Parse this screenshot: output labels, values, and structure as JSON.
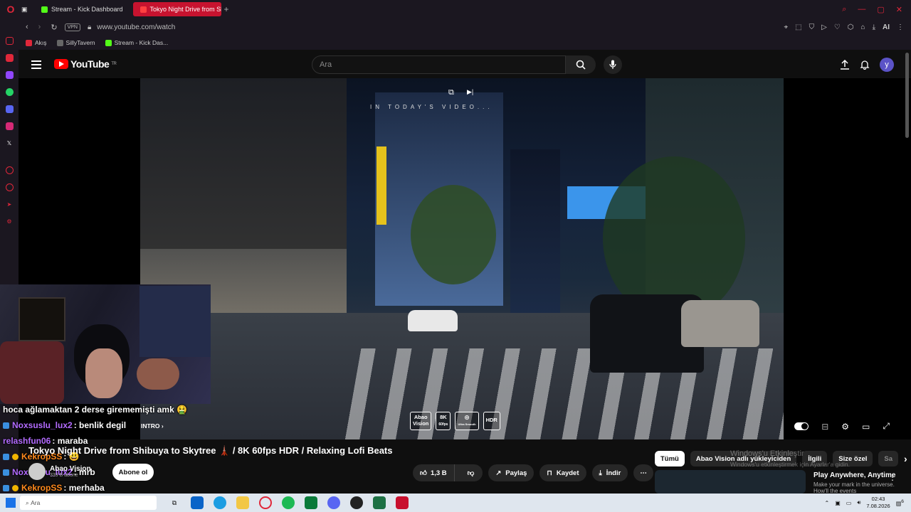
{
  "browser": {
    "tabs": [
      {
        "label": "Stream - Kick Dashboard",
        "active": false,
        "color": "#53fc18"
      },
      {
        "label": "Tokyo Night Drive from Shi",
        "active": true,
        "color": "#ff0000"
      }
    ],
    "new_tab": "+",
    "url": "www.youtube.com/watch",
    "vpn": "VPN",
    "ai_label": "AI",
    "bookmarks": [
      {
        "label": "Akış",
        "color": "#e0273a"
      },
      {
        "label": "SillyTavern",
        "color": "#444"
      },
      {
        "label": "Stream - Kick Das...",
        "color": "#53fc18"
      }
    ]
  },
  "youtube": {
    "logo": "YouTube",
    "logo_region": "TR",
    "search_placeholder": "Ara",
    "avatar_letter": "y"
  },
  "video": {
    "tagline": "IN TODAY'S VIDEO...",
    "badges": [
      "Abao\nVision",
      "8K\n60fps",
      "Ultra\nsmooth",
      "HDR"
    ],
    "chapter": "INTRO",
    "title": "Tokyo Night Drive from Shibuya to Skytree 🗼 / 8K 60fps HDR / Relaxing Lofi Beats",
    "channel": "Abao Vision",
    "subs": "339 B abone",
    "subscribe": "Abone ol",
    "likes": "1,3 B",
    "share": "Paylaş",
    "save": "Kaydet",
    "download": "İndir"
  },
  "chat": [
    {
      "user": "",
      "text": "hoca ağlamaktan 2 derse girememişti amk 🤮",
      "color": "#ffffff"
    },
    {
      "user": "Noxsuslu_lux2",
      "text": ": benlik degil",
      "color": "#b36bff"
    },
    {
      "user": "relashfun06",
      "text": ": maraba",
      "color": "#b36bff"
    },
    {
      "user": "KekropSS",
      "text": ": 😃",
      "color": "#ff8a1c"
    },
    {
      "user": "Noxsuslu_lux2",
      "text": ": mrb",
      "color": "#b36bff"
    },
    {
      "user": "KekropSS",
      "text": ": merhaba",
      "color": "#ff8a1c"
    }
  ],
  "sidebar_chips": [
    "Tümü",
    "Abao Vision adlı yükleyiciden",
    "İlgili",
    "Size özel",
    "Sa"
  ],
  "windows_activation": {
    "title": "Windows'u Etkinleştir",
    "subtitle": "Windows'u etkinleştirmek için Ayarlar'a gidin."
  },
  "recommendation": {
    "title": "Play Anywhere, Anytime",
    "sub": "Make your mark in the universe. How'll the events"
  },
  "taskbar": {
    "search": "Ara",
    "time": "02:43",
    "date": "7.08.2026",
    "notif": "6"
  }
}
